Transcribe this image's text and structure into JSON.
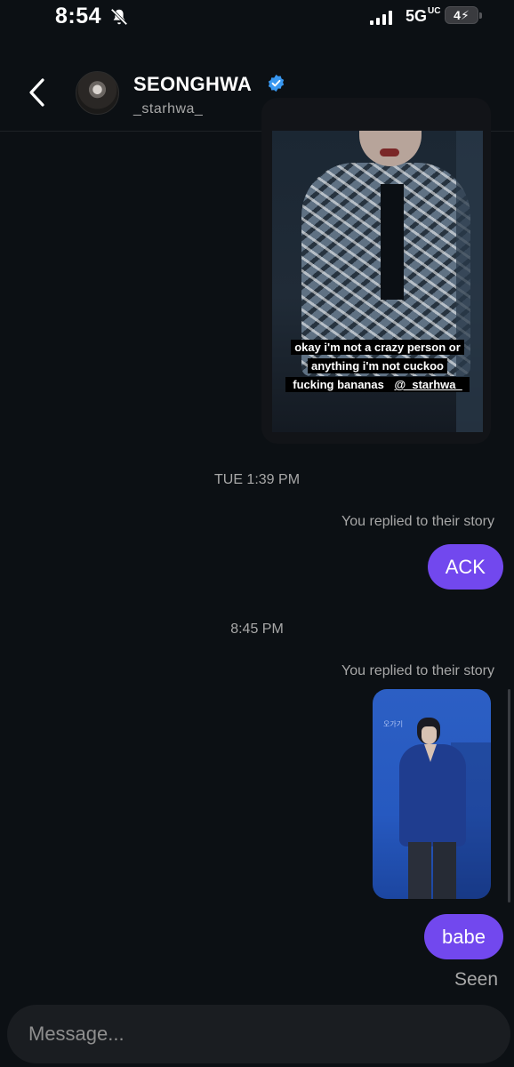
{
  "status_bar": {
    "time": "8:54",
    "network": "5G",
    "network_sup": "UC",
    "battery": "4"
  },
  "header": {
    "username": "SEONGHWA",
    "handle": "_starhwa_",
    "verified": true,
    "accent": "#3897f0"
  },
  "thread": {
    "story_caption_line1": "okay i'm not a crazy person or",
    "story_caption_line2": "anything i'm not cuckoo",
    "story_caption_line3_prefix": "fucking bananas ",
    "story_caption_mention": "@_starhwa_",
    "timestamp_1": "TUE 1:39 PM",
    "replied_note_1": "You replied to their story",
    "message_1": "ACK",
    "timestamp_2": "8:45 PM",
    "replied_note_2": "You replied to their story",
    "story_thumb_text": "오가기",
    "message_2": "babe",
    "seen_label": "Seen",
    "bubble_color": "#7248ee"
  },
  "composer": {
    "placeholder": "Message..."
  }
}
